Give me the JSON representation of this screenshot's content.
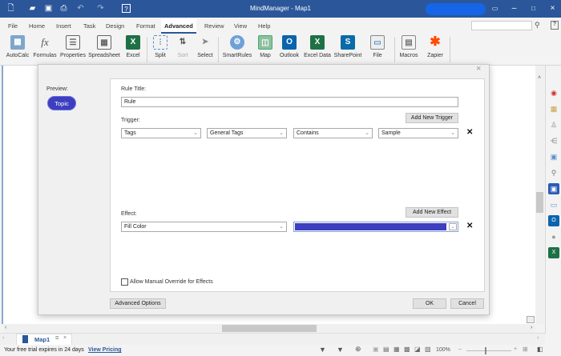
{
  "window": {
    "title": "MindManager - Map1"
  },
  "menu": {
    "tabs": [
      "File",
      "Home",
      "Insert",
      "Task",
      "Design",
      "Format",
      "Advanced",
      "Review",
      "View",
      "Help"
    ],
    "active": "Advanced"
  },
  "ribbon": {
    "buttons": [
      "AutoCalc",
      "Formulas",
      "Properties",
      "Spreadsheet",
      "Excel",
      "Split",
      "Sort",
      "Select",
      "SmartRules",
      "Map",
      "Outlook",
      "Excel Data",
      "SharePoint",
      "File",
      "Macros",
      "Zapier"
    ]
  },
  "dialog": {
    "preview_label": "Preview:",
    "preview_topic": "Topic",
    "rule_title_label": "Rule Title:",
    "rule_title_value": "Rule",
    "trigger_label": "Trigger:",
    "add_trigger": "Add New Trigger",
    "trigger": {
      "field": "Tags",
      "group": "General Tags",
      "operator": "Contains",
      "value": "Sample"
    },
    "effect_label": "Effect:",
    "add_effect": "Add New Effect",
    "effect": {
      "type": "Fill Color",
      "color": "#3d3fbf"
    },
    "allow_override": "Allow Manual Override for Effects",
    "allow_override_checked": false,
    "advanced_options": "Advanced Options",
    "ok": "OK",
    "cancel": "Cancel"
  },
  "doc_tab": "Map1",
  "status": {
    "trial": "Your free trial expires in 24 days",
    "view_pricing": "View Pricing",
    "zoom": "100%"
  },
  "colors": {
    "titlebar": "#2b579a",
    "topic": "#3d3fbf"
  }
}
